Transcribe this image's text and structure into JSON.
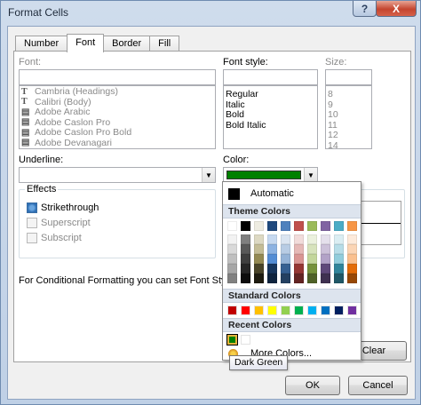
{
  "window": {
    "title": "Format Cells",
    "help_label": "?",
    "close_label": "X"
  },
  "tabs": [
    {
      "label": "Number"
    },
    {
      "label": "Font"
    },
    {
      "label": "Border"
    },
    {
      "label": "Fill"
    }
  ],
  "font": {
    "label": "Font:",
    "value": "",
    "items": [
      "Cambria (Headings)",
      "Calibri (Body)",
      "Adobe Arabic",
      "Adobe Caslon Pro",
      "Adobe Caslon Pro Bold",
      "Adobe Devanagari"
    ],
    "icon_glyph": "T"
  },
  "font_style": {
    "label": "Font style:",
    "value": "",
    "items": [
      "Regular",
      "Italic",
      "Bold",
      "Bold Italic"
    ]
  },
  "size": {
    "label": "Size:",
    "value": "",
    "items": [
      "8",
      "9",
      "10",
      "11",
      "12",
      "14"
    ]
  },
  "underline": {
    "label": "Underline:",
    "value": ""
  },
  "color": {
    "label": "Color:",
    "value": "#008000"
  },
  "effects": {
    "label": "Effects",
    "options": [
      {
        "label": "Strikethrough",
        "checked": true,
        "enabled": true
      },
      {
        "label": "Superscript",
        "checked": false,
        "enabled": false
      },
      {
        "label": "Subscript",
        "checked": false,
        "enabled": false
      }
    ]
  },
  "info_text": "For Conditional Formatting you can set Font Style, Un",
  "clear_label": "Clear",
  "buttons": {
    "ok": "OK",
    "cancel": "Cancel"
  },
  "color_popup": {
    "automatic_label": "Automatic",
    "theme_header": "Theme Colors",
    "standard_header": "Standard Colors",
    "recent_header": "Recent Colors",
    "more_colors_label": "More Colors...",
    "theme_colors": [
      [
        "#ffffff",
        "#f2f2f2",
        "#d9d9d9",
        "#bfbfbf",
        "#a6a6a6",
        "#808080"
      ],
      [
        "#000000",
        "#7f7f7f",
        "#595959",
        "#3f3f3f",
        "#262626",
        "#0d0d0d"
      ],
      [
        "#eeece1",
        "#ddd9c3",
        "#c4bd97",
        "#948a54",
        "#4a452a",
        "#1e1c11"
      ],
      [
        "#1f497d",
        "#c6d9f0",
        "#8db3e2",
        "#548dd4",
        "#17365d",
        "#0f243e"
      ],
      [
        "#4f81bd",
        "#dbe5f1",
        "#b8cce4",
        "#95b3d7",
        "#366092",
        "#244061"
      ],
      [
        "#c0504d",
        "#f2dcdb",
        "#e5b9b7",
        "#d99694",
        "#953734",
        "#632423"
      ],
      [
        "#9bbb59",
        "#ebf1dd",
        "#d7e3bc",
        "#c3d69b",
        "#76923c",
        "#4f6128"
      ],
      [
        "#8064a2",
        "#e5e0ec",
        "#ccc1d9",
        "#b2a2c7",
        "#5f497a",
        "#3f3151"
      ],
      [
        "#4bacc6",
        "#dbeef3",
        "#b7dde8",
        "#92cddc",
        "#31859b",
        "#205867"
      ],
      [
        "#f79646",
        "#fdeada",
        "#fbd5b5",
        "#fac08f",
        "#e36c09",
        "#974806"
      ]
    ],
    "standard_colors": [
      "#c00000",
      "#ff0000",
      "#ffc000",
      "#ffff00",
      "#92d050",
      "#00b050",
      "#00b0f0",
      "#0070c0",
      "#002060",
      "#7030a0"
    ],
    "recent_colors": [
      "#008000",
      "#ffffff"
    ]
  },
  "tooltip": "Dark Green"
}
